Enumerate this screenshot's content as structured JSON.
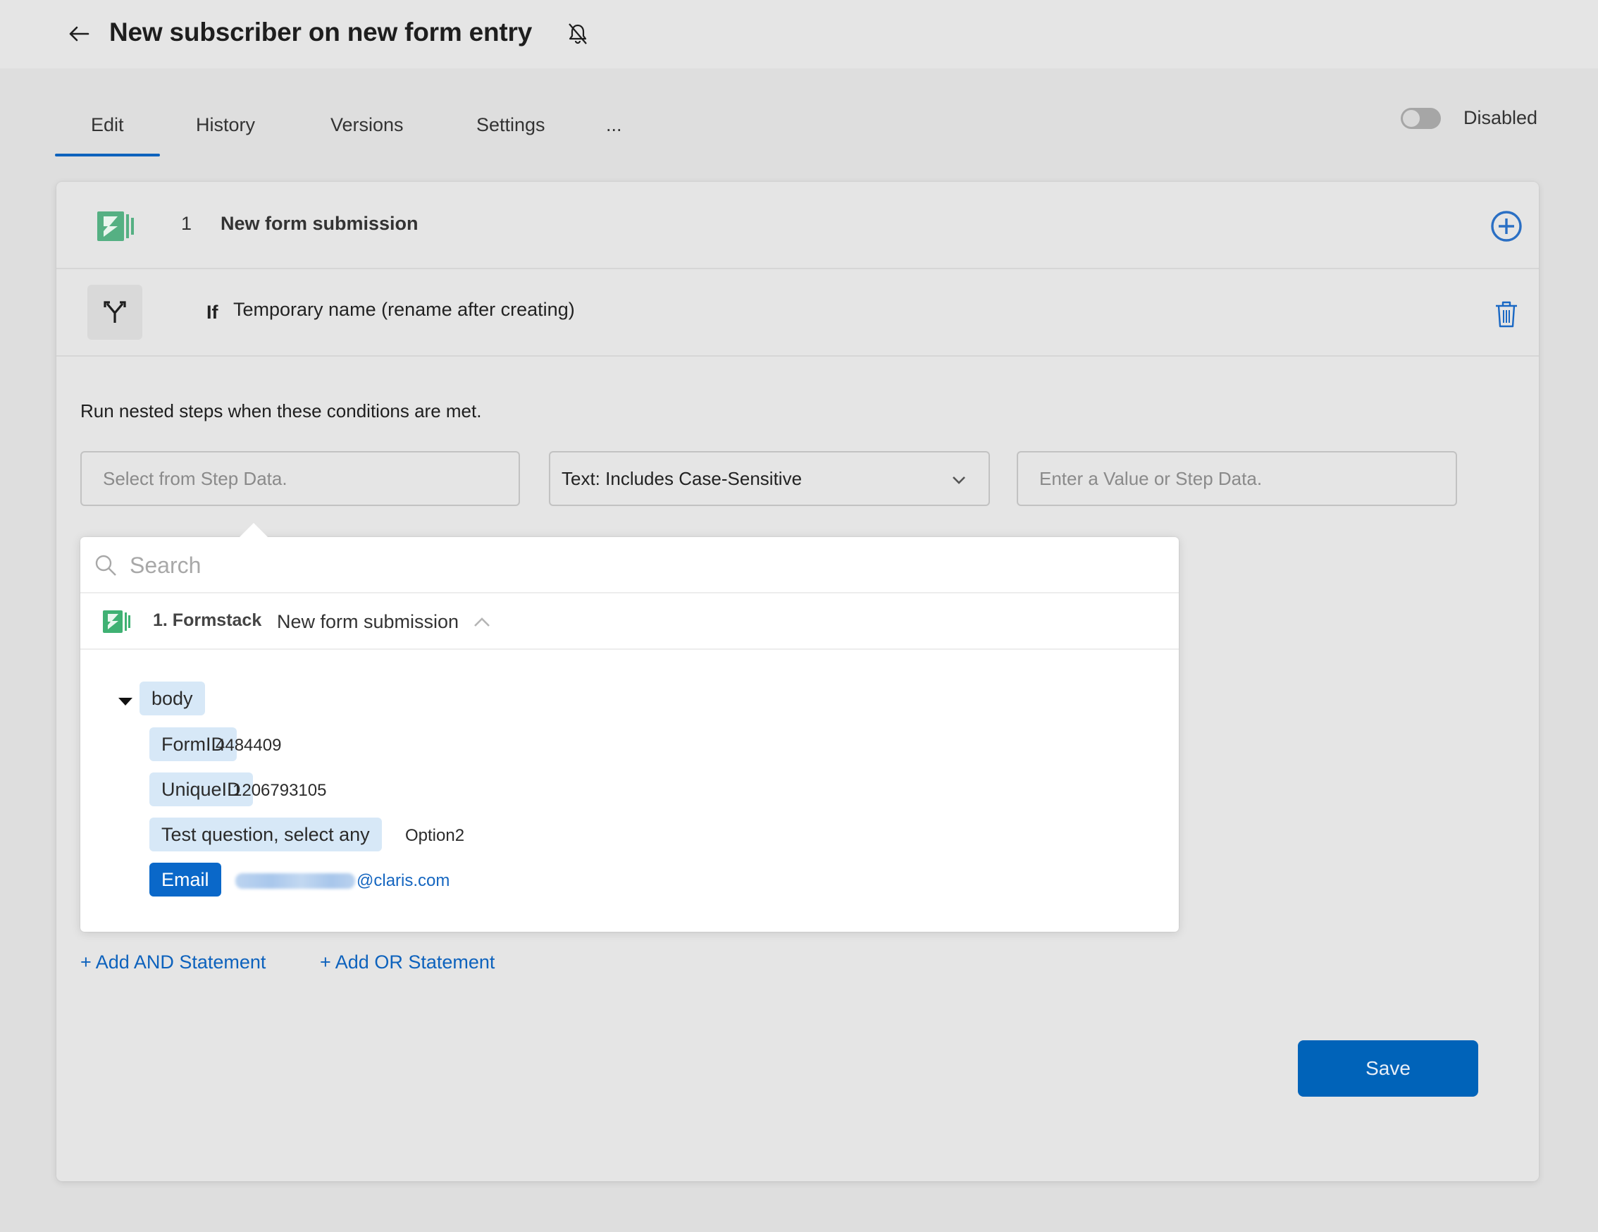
{
  "header": {
    "title": "New subscriber on new form entry",
    "back_icon": "arrow-left-icon",
    "notification_icon": "bell-off-icon"
  },
  "tabs": [
    {
      "label": "Edit",
      "active": true
    },
    {
      "label": "History",
      "active": false
    },
    {
      "label": "Versions",
      "active": false
    },
    {
      "label": "Settings",
      "active": false
    },
    {
      "label": "...",
      "active": false
    }
  ],
  "status_toggle": {
    "label": "Disabled",
    "enabled": false
  },
  "steps": [
    {
      "number": "1",
      "title": "New form submission",
      "icon": "formstack-icon",
      "action_icon": "add-circle-icon"
    },
    {
      "keyword": "If",
      "title": "Temporary name (rename after creating)",
      "icon": "branch-icon",
      "action_icon": "trash-icon"
    }
  ],
  "condition": {
    "description": "Run nested steps when these conditions are met.",
    "field_placeholder": "Select from Step Data.",
    "operator": "Text: Includes Case-Sensitive",
    "value_placeholder": "Enter a Value or Step Data."
  },
  "step_data_picker": {
    "search_placeholder": "Search",
    "source": {
      "step": "1. Formstack",
      "name": "New form submission",
      "expanded": true
    },
    "tree": {
      "root": "body",
      "fields": [
        {
          "key": "FormID",
          "value": "4484409",
          "selected": false
        },
        {
          "key": "UniqueID",
          "value": "1206793105",
          "selected": false
        },
        {
          "key": "Test question, select any",
          "value": "Option2",
          "selected": false
        },
        {
          "key": "Email",
          "value": "@claris.com",
          "selected": true
        }
      ]
    }
  },
  "links": {
    "add_and": "+ Add AND Statement",
    "add_or": "+ Add OR Statement"
  },
  "save_label": "Save",
  "colors": {
    "accent": "#0d62bd",
    "save": "#0063b9",
    "chip": "#d7e8f7",
    "chip_selected": "#0a68c9",
    "formstack_green": "#55b083"
  }
}
